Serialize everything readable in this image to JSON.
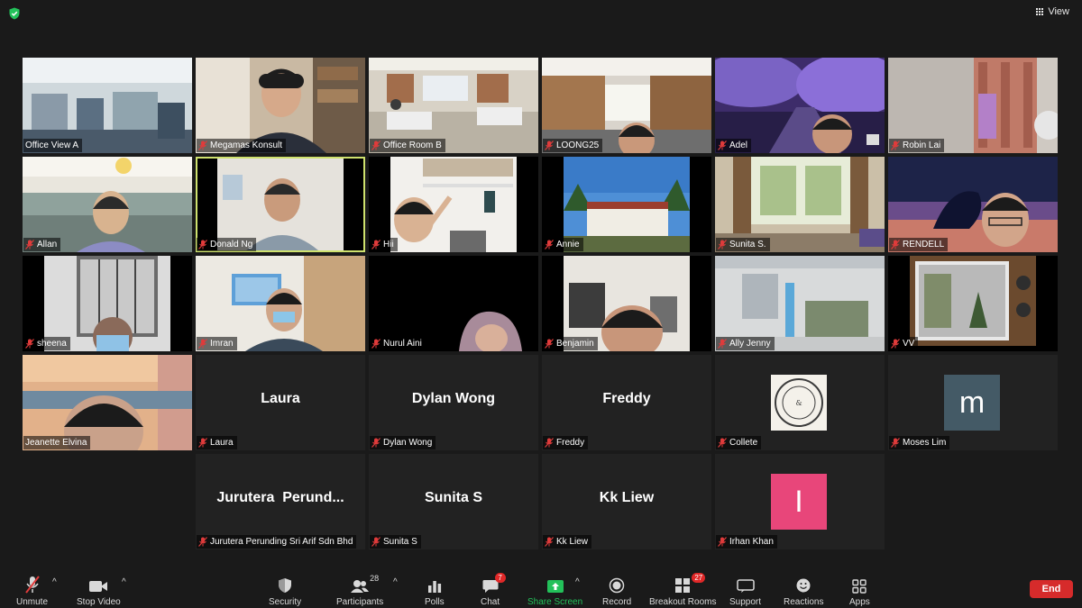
{
  "top": {
    "view_label": "View"
  },
  "tiles": [
    {
      "name": "Office View A",
      "mic_muted": false
    },
    {
      "name": "Megamas Konsult",
      "mic_muted": true
    },
    {
      "name": "Office Room B",
      "mic_muted": true
    },
    {
      "name": "LOONG25",
      "mic_muted": true
    },
    {
      "name": "Adel",
      "mic_muted": true
    },
    {
      "name": "Robin Lai",
      "mic_muted": true
    },
    {
      "name": "Allan",
      "mic_muted": true
    },
    {
      "name": "Donald Ng",
      "mic_muted": true
    },
    {
      "name": "Hii",
      "mic_muted": true
    },
    {
      "name": "Annie",
      "mic_muted": true
    },
    {
      "name": "Sunita S.",
      "mic_muted": true
    },
    {
      "name": "RENDELL",
      "mic_muted": true
    },
    {
      "name": "sheena",
      "mic_muted": true
    },
    {
      "name": "Imran",
      "mic_muted": true
    },
    {
      "name": "Nurul Aini",
      "mic_muted": true
    },
    {
      "name": "Benjamin",
      "mic_muted": true
    },
    {
      "name": "Ally Jenny",
      "mic_muted": true
    },
    {
      "name": "VV",
      "mic_muted": true
    },
    {
      "name": "Jeanette Elvina",
      "mic_muted": false
    },
    {
      "name": "Laura",
      "mic_muted": true,
      "display": "Laura"
    },
    {
      "name": "Dylan Wong",
      "mic_muted": true,
      "display": "Dylan Wong"
    },
    {
      "name": "Freddy",
      "mic_muted": true,
      "display": "Freddy"
    },
    {
      "name": "Collete",
      "mic_muted": true,
      "avatar_image_text": "STAY SAFE & HEALTHY"
    },
    {
      "name": "Moses Lim",
      "mic_muted": true,
      "avatar_letter": "m",
      "avatar_color": "#445a66"
    },
    {
      "name": "Jurutera Perunding Sri Arif Sdn Bhd",
      "mic_muted": true,
      "display": "Jurutera  Perund..."
    },
    {
      "name": "Sunita S",
      "mic_muted": true,
      "display": "Sunita S"
    },
    {
      "name": "Kk Liew",
      "mic_muted": true,
      "display": "Kk Liew"
    },
    {
      "name": "Irhan Khan",
      "mic_muted": true,
      "avatar_letter": "I",
      "avatar_color": "#e8467a"
    }
  ],
  "toolbar": {
    "unmute": "Unmute",
    "stop_video": "Stop Video",
    "security": "Security",
    "participants": "Participants",
    "participants_count": "28",
    "polls": "Polls",
    "chat": "Chat",
    "chat_badge": "7",
    "share_screen": "Share Screen",
    "record": "Record",
    "breakout_rooms": "Breakout Rooms",
    "breakout_badge": "27",
    "support": "Support",
    "reactions": "Reactions",
    "apps": "Apps",
    "end": "End"
  },
  "colors": {
    "share_green": "#23c15a",
    "end_red": "#d62b2b",
    "badge_red": "#e02828",
    "active_outline": "#cfe26e"
  }
}
